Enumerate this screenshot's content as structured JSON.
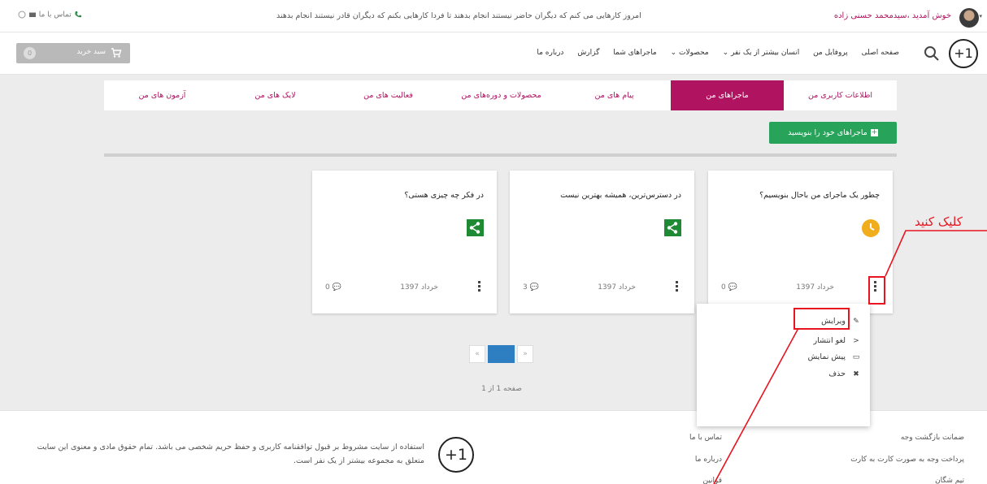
{
  "topbar": {
    "welcome": "خوش آمدید ،سیدمحمد حسنی زاده",
    "slogan": "امروز کارهایی می کنم که دیگران حاضر نیستند انجام بدهند تا فردا کارهایی بکنم که دیگران قادر نیستند انجام بدهند",
    "contact": "تماس با ما"
  },
  "navbar": {
    "logo_text": "+1",
    "menu": [
      "صفحه اصلی",
      "پروفایل من",
      "انسان بیشتر از یک نفر ⌄",
      "محصولات ⌄",
      "ماجراهای شما",
      "گزارش",
      "درباره ما"
    ],
    "cart_label": "سبد خرید",
    "cart_count": "0"
  },
  "tabs": [
    {
      "label": "اطلاعات کاربری من",
      "active": false
    },
    {
      "label": "ماجراهای من",
      "active": true
    },
    {
      "label": "پیام های من",
      "active": false
    },
    {
      "label": "محصولات و دوره‌های من",
      "active": false
    },
    {
      "label": "فعالیت های من",
      "active": false
    },
    {
      "label": "لایک های من",
      "active": false
    },
    {
      "label": "آزمون های من",
      "active": false
    }
  ],
  "write_button": "ماجراهای خود را بنویسید",
  "cards": [
    {
      "title": "چطور یک ماجرای من باحال بنویسیم؟",
      "status_icon": "clock-icon",
      "date": "خرداد 1397",
      "comments": "0"
    },
    {
      "title": "در دسترس‌ترین، همیشه بهترین نیست",
      "status_icon": "share-icon",
      "date": "خرداد 1397",
      "comments": "3"
    },
    {
      "title": "در فکر چه چیزی هستی؟",
      "status_icon": "share-icon",
      "date": "خرداد 1397",
      "comments": "0"
    }
  ],
  "dropdown": [
    {
      "label": "ویرایش",
      "icon": "pencil-icon"
    },
    {
      "label": "لغو انتشار",
      "icon": "share-icon"
    },
    {
      "label": "پیش نمایش",
      "icon": "monitor-icon"
    },
    {
      "label": "حذف",
      "icon": "close-icon"
    }
  ],
  "pagination": {
    "prev": "«",
    "current": "1",
    "next": "»",
    "info": "صفحه 1 از 1"
  },
  "footer": {
    "text": "استفاده از سایت مشروط بر قبول توافقنامه کاربری و حفظ حریم شخصی می باشد. تمام حقوق مادی و معنوی این سایت متعلق به مجموعه بیشتر از یک نفر است.",
    "logo_text": "+1",
    "links_right": [
      "ضمانت بازگشت وجه",
      "پرداخت وجه به صورت کارت به کارت",
      "تیم شگان"
    ],
    "links_left": [
      "تماس با ما",
      "درباره ما",
      "قوانین"
    ]
  },
  "annotation": {
    "note": "کلیک کنید",
    "color": "#e8141f"
  },
  "colors": {
    "brand": "#b0135f",
    "green": "#27a35a",
    "share": "#1f8a34",
    "clock": "#f0ad1c",
    "pager": "#2d7fc1"
  }
}
